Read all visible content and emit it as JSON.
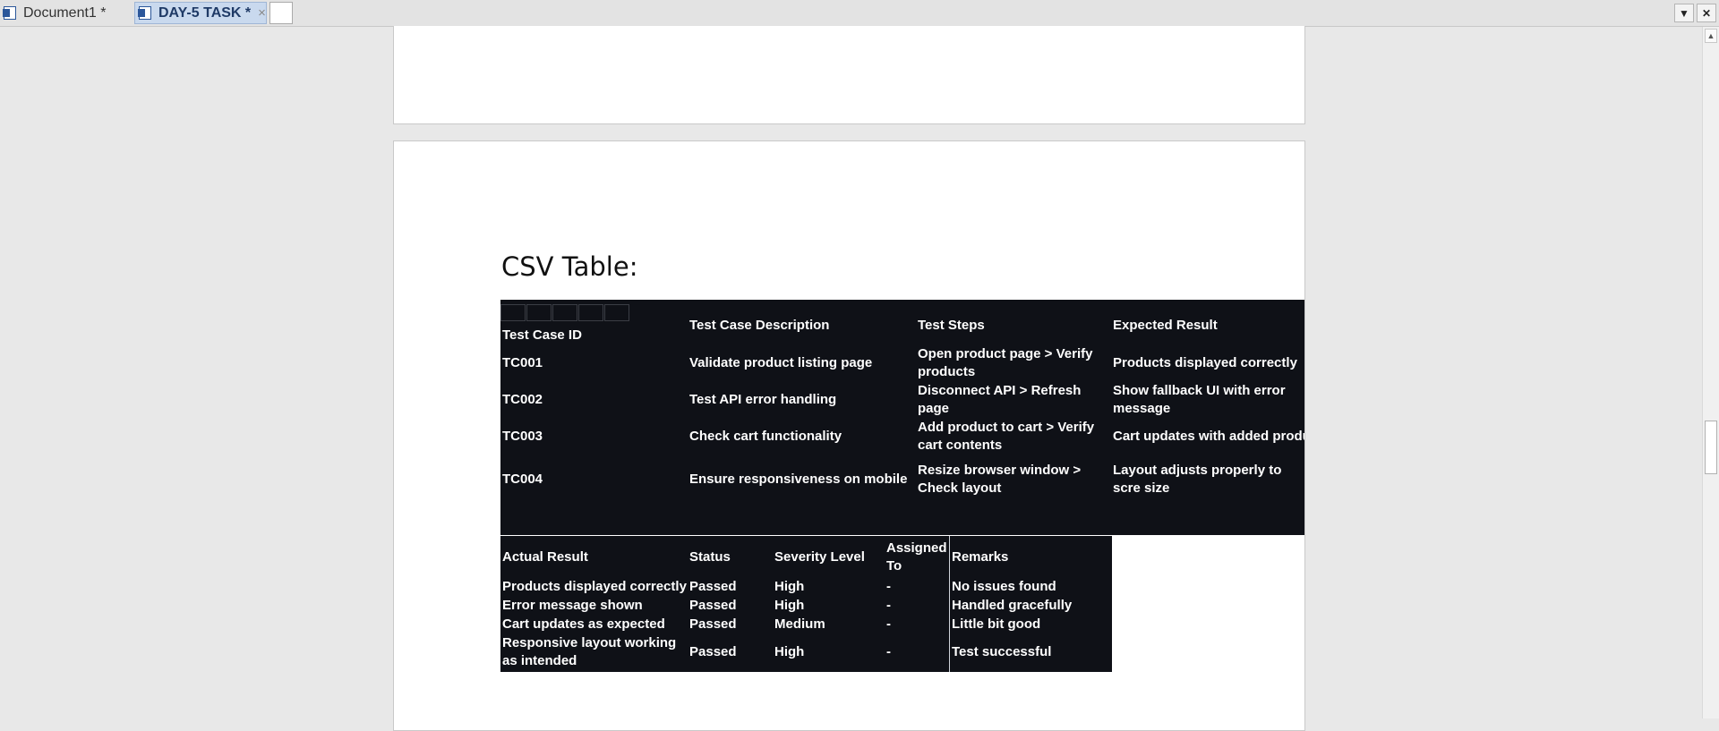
{
  "tabs": [
    {
      "label": "Document1 *",
      "close": ""
    },
    {
      "label": "DAY-5 TASK *",
      "close": "×"
    }
  ],
  "toolbar": {
    "menu_icon": "▼",
    "close_icon": "✕"
  },
  "document": {
    "heading": "CSV Table:",
    "table1": {
      "headers": [
        "Test Case ID",
        "Test Case Description",
        "Test Steps",
        "Expected Result"
      ],
      "rows": [
        [
          "TC001",
          "Validate product listing page",
          "Open product page > Verify products",
          "Products displayed correctly"
        ],
        [
          "TC002",
          "Test API error handling",
          "Disconnect API > Refresh page",
          "Show fallback UI with error message"
        ],
        [
          "TC003",
          "Check cart functionality",
          "Add product to cart > Verify cart contents",
          "Cart updates with added produ"
        ],
        [
          "TC004",
          "Ensure responsiveness on mobile",
          "Resize browser window > Check layout",
          "Layout adjusts properly to scre size"
        ]
      ]
    },
    "table2": {
      "headers": [
        "Actual Result",
        "Status",
        "Severity Level",
        "Assigned To",
        "Remarks"
      ],
      "rows": [
        [
          "Products displayed correctly",
          "Passed",
          "High",
          "-",
          "No issues found"
        ],
        [
          "Error message shown",
          "Passed",
          "High",
          "-",
          "Handled gracefully"
        ],
        [
          "Cart updates as expected",
          "Passed",
          "Medium",
          "-",
          "Little bit good"
        ],
        [
          "Responsive layout working as intended",
          "Passed",
          "High",
          "-",
          "Test successful"
        ]
      ]
    }
  },
  "scrollbar": {
    "up_icon": "▲"
  }
}
